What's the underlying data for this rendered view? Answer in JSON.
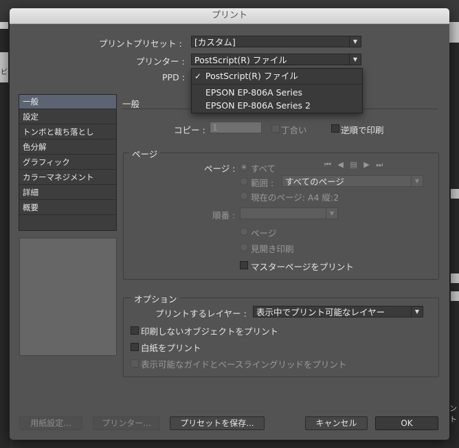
{
  "window": {
    "title": "プリント"
  },
  "background": {
    "left_glyph": "ビ",
    "right_text": "ント"
  },
  "preset": {
    "label": "プリントプリセット :",
    "value": "[カスタム]"
  },
  "printer": {
    "label": "プリンター :",
    "value": "PostScript(R) ファイル"
  },
  "ppd": {
    "label": "PPD :"
  },
  "printer_menu": {
    "items": [
      {
        "label": "PostScript(R) ファイル",
        "checked": true
      },
      {
        "label": "EPSON EP-806A Series",
        "checked": false
      },
      {
        "label": "EPSON EP-806A Series 2",
        "checked": false
      }
    ]
  },
  "sidebar": {
    "items": [
      {
        "label": "一般",
        "selected": true
      },
      {
        "label": "設定"
      },
      {
        "label": "トンボと裁ち落とし"
      },
      {
        "label": "色分解"
      },
      {
        "label": "グラフィック"
      },
      {
        "label": "カラーマネジメント"
      },
      {
        "label": "詳細"
      },
      {
        "label": "概要"
      }
    ]
  },
  "general": {
    "title": "一般",
    "copies_label": "コピー :",
    "copies_value": "1",
    "collate_label": "丁合い",
    "reverse_label": "逆順で印刷"
  },
  "pages": {
    "title": "ページ",
    "pages_label": "ページ :",
    "all_label": "すべて",
    "range_label": "範囲 :",
    "range_value": "すべてのページ",
    "current_label": "現在のページ: A4 縦:2",
    "order_label": "順番 :",
    "order_value": "",
    "page_label": "ページ",
    "spread_label": "見開き印刷",
    "master_label": "マスターページをプリント",
    "nav_icons": "⏮ ◀ ▤ ▶ ⏭"
  },
  "options": {
    "title": "オプション",
    "layer_label": "プリントするレイヤー :",
    "layer_value": "表示中でプリント可能なレイヤー",
    "nonprint_label": "印刷しないオブジェクトをプリント",
    "blank_label": "白紙をプリント",
    "guides_label": "表示可能なガイドとベースライングリッドをプリント"
  },
  "buttons": {
    "page_setup": "用紙設定...",
    "printer": "プリンター...",
    "save_preset": "プリセットを保存...",
    "cancel": "キャンセル",
    "ok": "OK"
  }
}
